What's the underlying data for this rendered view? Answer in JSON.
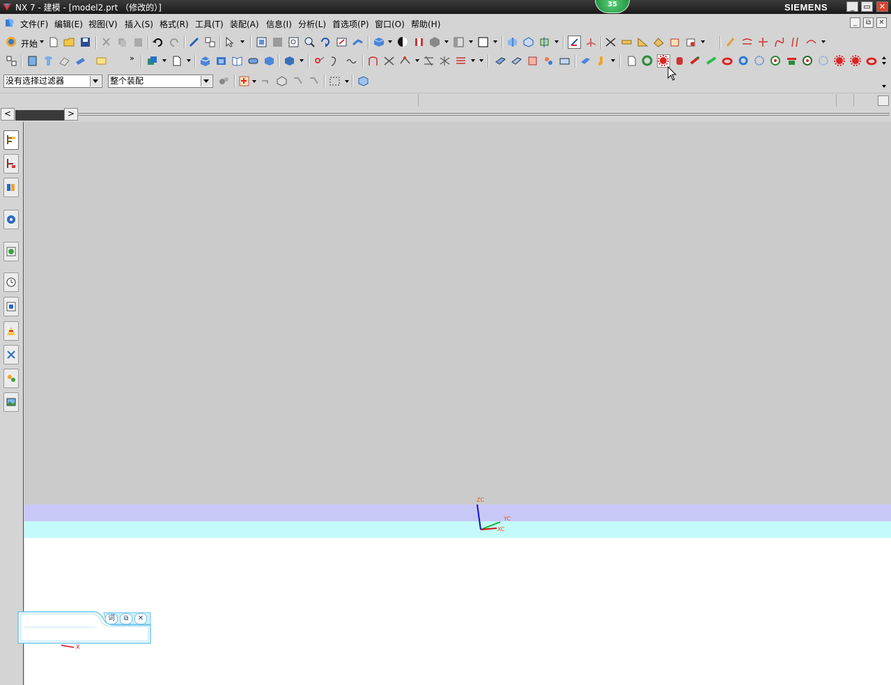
{
  "window": {
    "title": "NX 7 - 建模 - [model2.prt （修改的）]",
    "badge": "35",
    "brand": "SIEMENS",
    "controls": [
      "_",
      "▭",
      "✕"
    ]
  },
  "menubar": {
    "items": [
      "文件(F)",
      "编辑(E)",
      "视图(V)",
      "插入(S)",
      "格式(R)",
      "工具(T)",
      "装配(A)",
      "信息(I)",
      "分析(L)",
      "首选项(P)",
      "窗口(O)",
      "帮助(H)"
    ],
    "mdi_controls": [
      "_",
      "⧉",
      "✕"
    ]
  },
  "toolbar1": {
    "start_label": "开始"
  },
  "selection_bar": {
    "filter_value": "没有选择过滤器",
    "scope_value": "整个装配"
  },
  "triad": {
    "z": "ZC",
    "y": "YC",
    "x": "XC",
    "small_x": "X"
  },
  "float_panel": {
    "buttons": [
      "词",
      "⧉",
      "✕"
    ]
  },
  "colors": {
    "viewport_gray": "#cbcbcb",
    "band_lavender": "#c8c8f8",
    "band_cyan": "#c4fafa",
    "accent_red": "#d9442e",
    "badge_green": "#1c8c3a"
  }
}
